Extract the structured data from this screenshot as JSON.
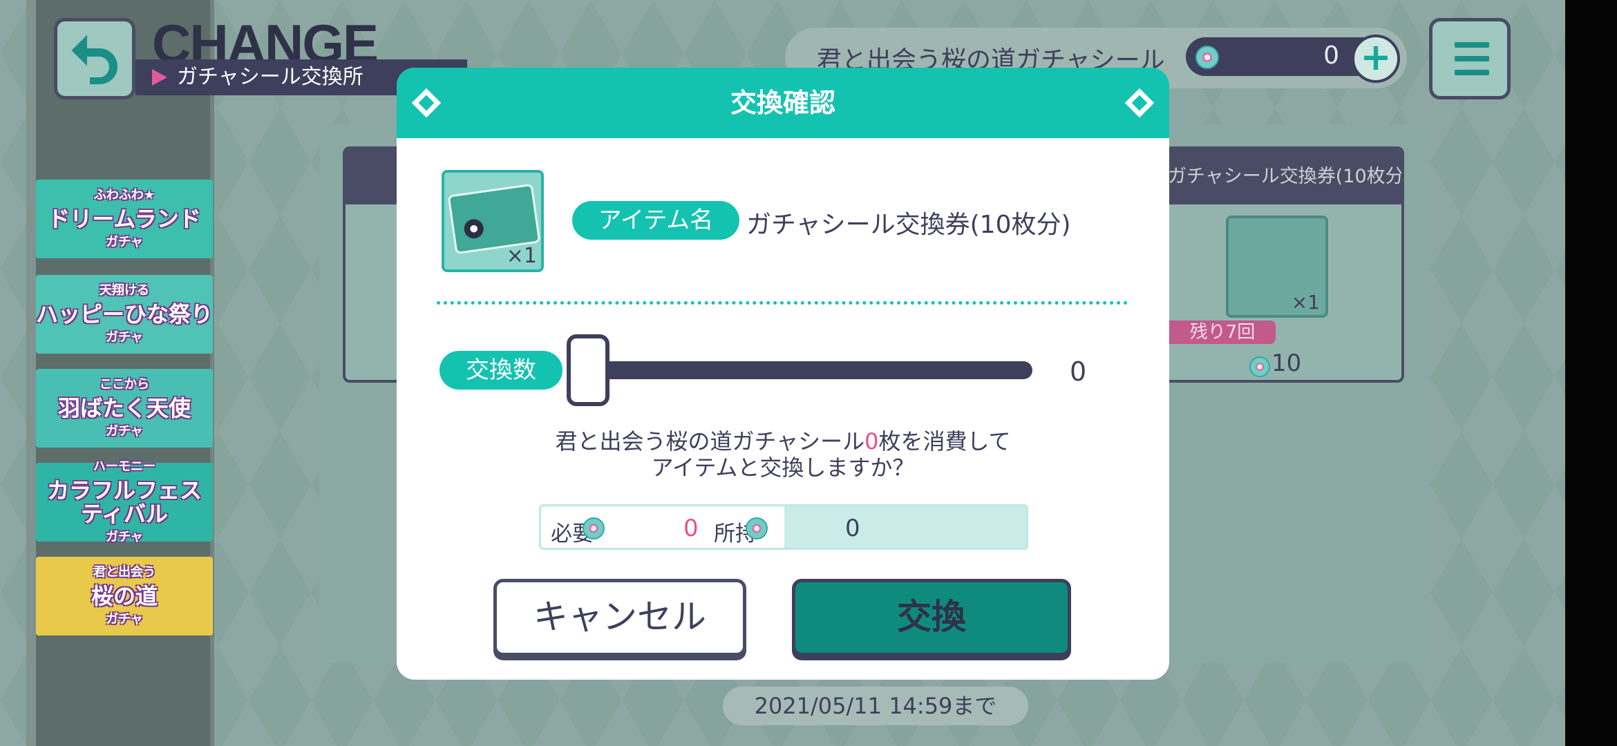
{
  "header": {
    "title": "CHANGE",
    "subtitle": "ガチャシール交換所",
    "currency_name": "君と出会う桜の道ガチャシール",
    "currency_count": "0",
    "plus": "+"
  },
  "banners": [
    {
      "line1": "ふわふわ★",
      "line2": "ドリームランド",
      "line3": "ガチャ",
      "bg": "#3dbfae"
    },
    {
      "line1": "天翔ける",
      "line2": "ハッピーひな祭り",
      "line3": "ガチャ",
      "bg": "#4fc3b6"
    },
    {
      "line1": "ここから",
      "line2": "羽ばたく天使",
      "line3": "ガチャ",
      "bg": "#49bfb3"
    },
    {
      "line1": "ハーモニー",
      "line2": "カラフルフェスティバル",
      "line3": "ガチャ",
      "bg": "#2fb5a6"
    },
    {
      "line1": "君と出会う",
      "line2": "桜の道",
      "line3": "ガチャ",
      "bg": "#e9c94a"
    }
  ],
  "background_card": {
    "header": "ガチャシール交換券(10枚分)",
    "quantity": "×1",
    "remaining": "残り7回",
    "price": "10"
  },
  "deadline": "2021/05/11 14:59まで",
  "modal": {
    "title": "交換確認",
    "item_label": "アイテム名",
    "item_name": "ガチャシール交換券(10枚分)",
    "item_quantity": "×1",
    "quantity_label": "交換数",
    "slider_value": "0",
    "confirm_line1_a": "君と出会う桜の道ガチャシール",
    "confirm_count": "0",
    "confirm_line1_b": "枚を消費して",
    "confirm_line2": "アイテムと交換しますか？",
    "required_label": "必要",
    "required_value": "0",
    "owned_label": "所持",
    "owned_value": "0",
    "cancel_label": "キャンセル",
    "exchange_label": "交換"
  },
  "colors": {
    "accent": "#14c2b0",
    "highlight": "#e5508f",
    "dark": "#3d3f5c"
  }
}
